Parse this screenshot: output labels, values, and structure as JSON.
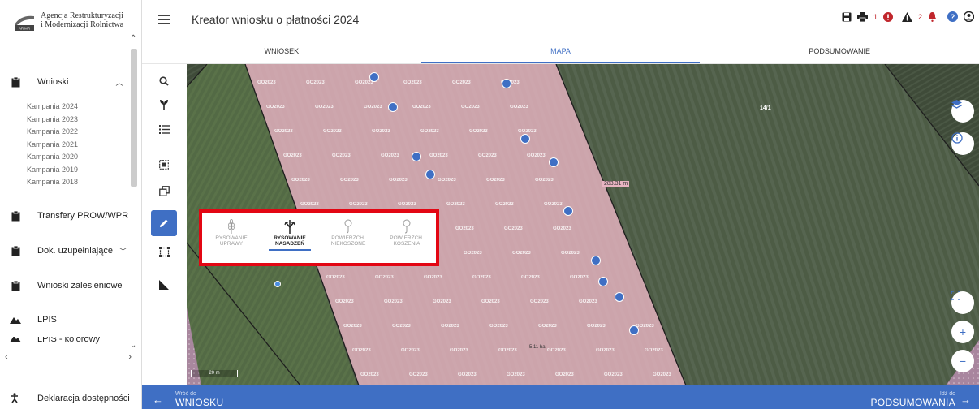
{
  "app": {
    "logo_line1": "Agencja Restrukturyzacji",
    "logo_line2": "i Modernizacji Rolnictwa",
    "title": "Kreator wniosku o płatności 2024"
  },
  "sidebar": {
    "wnioski": "Wnioski",
    "kampanie": [
      "Kampania 2024",
      "Kampania 2023",
      "Kampania 2022",
      "Kampania 2021",
      "Kampania 2020",
      "Kampania 2019",
      "Kampania 2018"
    ],
    "transfery": "Transfery PROW/WPR",
    "dok": "Dok. uzupełniające",
    "zalesieniowe": "Wnioski zalesieniowe",
    "lpis": "LPIS",
    "lpis_kolorowy": "LPIS - kolorowy",
    "deklaracja": "Deklaracja dostępności"
  },
  "header": {
    "errors_count": "1",
    "warnings_count": "2"
  },
  "tabs": [
    "WNIOSEK",
    "MAPA",
    "PODSUMOWANIE"
  ],
  "map": {
    "overlay_label": "GO2023",
    "parcel_label": "14/1",
    "dim_label": "283.31 m",
    "area_label": "5.11 ha",
    "scale": "20 m"
  },
  "popup": {
    "items": [
      {
        "l1": "RYSOWANIE",
        "l2": "UPRAWY"
      },
      {
        "l1": "RYSOWANIE",
        "l2": "NASADZEŃ"
      },
      {
        "l1": "POWIERZCH.",
        "l2": "NIEKOSZONE"
      },
      {
        "l1": "POWIERZCH.",
        "l2": "KOSZENIA"
      }
    ]
  },
  "bottom": {
    "back_small": "Wróć do",
    "back_big": "WNIOSKU",
    "next_small": "Idź do",
    "next_big": "PODSUMOWANIA"
  },
  "colors": {
    "accent": "#3f6fc4",
    "error": "#c0262c",
    "highlight": "#e30613",
    "overlay": "#e8b4c2"
  }
}
